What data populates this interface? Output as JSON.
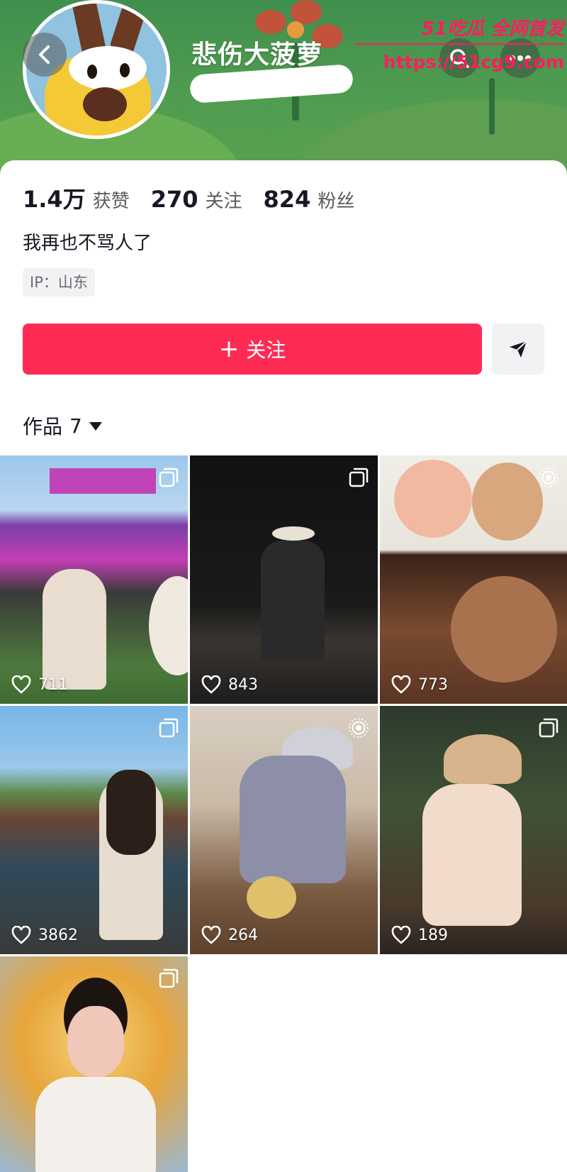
{
  "watermark": {
    "line1": "51吃瓜 全网首发",
    "line2": "https://51cg9.com"
  },
  "profile": {
    "nickname": "悲伤大菠萝",
    "bio": "我再也不骂人了",
    "ip": "IP：山东"
  },
  "stats": [
    {
      "value": "1.4万",
      "label": "获赞"
    },
    {
      "value": "270",
      "label": "关注"
    },
    {
      "value": "824",
      "label": "粉丝"
    }
  ],
  "actions": {
    "follow_plus": "+",
    "follow_label": "关注"
  },
  "tabs": {
    "works_label": "作品",
    "works_count": "7"
  },
  "colors": {
    "accent": "#fe2c55",
    "banner": "#4d9a50",
    "watermark": "#ff1d5e"
  },
  "icons": [
    "back-icon",
    "search-icon",
    "more-icon",
    "share-icon",
    "heart-icon",
    "carousel-icon",
    "live-photo-icon"
  ],
  "posts": [
    {
      "likes": "711",
      "badge": "carousel"
    },
    {
      "likes": "843",
      "badge": "carousel"
    },
    {
      "likes": "773",
      "badge": "live-photo"
    },
    {
      "likes": "3862",
      "badge": "carousel"
    },
    {
      "likes": "264",
      "badge": "live-photo"
    },
    {
      "likes": "189",
      "badge": "carousel"
    },
    {
      "likes": "",
      "badge": "carousel"
    }
  ]
}
